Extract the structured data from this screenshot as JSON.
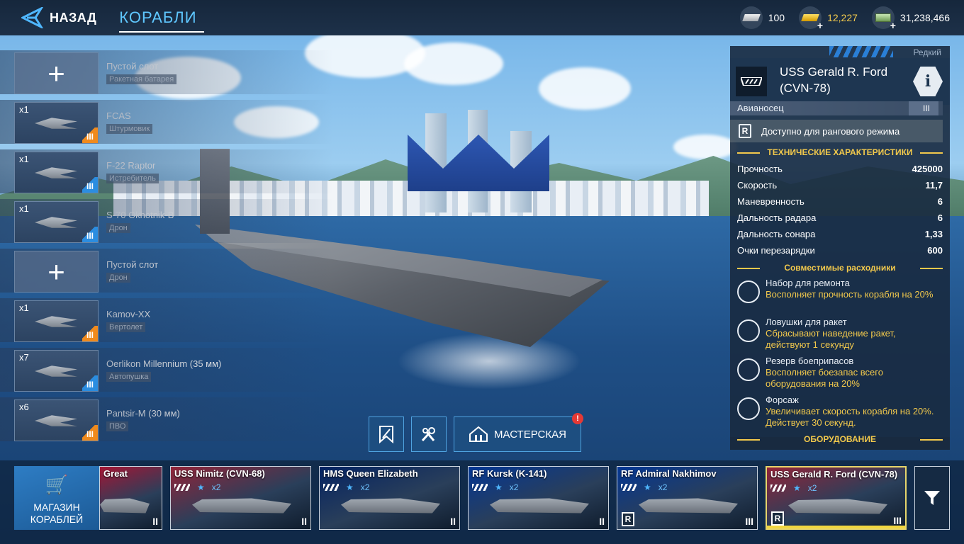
{
  "header": {
    "back_label": "НАЗАД",
    "title": "КОРАБЛИ",
    "currencies": [
      {
        "icon": "silver-bar-icon",
        "value": "100"
      },
      {
        "icon": "gold-bar-icon",
        "value": "12,227"
      },
      {
        "icon": "cash-icon",
        "value": "31,238,466"
      }
    ]
  },
  "slots": [
    {
      "qty": "",
      "name": "Пустой слот",
      "type": "Ракетная батарея",
      "empty": true
    },
    {
      "qty": "x1",
      "name": "FCAS",
      "type": "Штурмовик",
      "rank": "III",
      "color": "#f08a1c"
    },
    {
      "qty": "x1",
      "name": "F-22 Raptor",
      "type": "Истребитель",
      "rank": "III",
      "color": "#2b8de0"
    },
    {
      "qty": "x1",
      "name": "S-70 Okhotnik-B",
      "type": "Дрон",
      "rank": "III",
      "color": "#2b8de0"
    },
    {
      "qty": "",
      "name": "Пустой слот",
      "type": "Дрон",
      "empty": true
    },
    {
      "qty": "x1",
      "name": "Kamov-XX",
      "type": "Вертолет",
      "rank": "III",
      "color": "#f08a1c"
    },
    {
      "qty": "x7",
      "name": "Oerlikon Millennium (35 мм)",
      "type": "Автопушка",
      "rank": "III",
      "color": "#2b8de0"
    },
    {
      "qty": "x6",
      "name": "Pantsir-M (30 мм)",
      "type": "ПВО",
      "rank": "III",
      "color": "#f08a1c"
    }
  ],
  "panel": {
    "rarity": "Редкий",
    "ship_name": "USS Gerald R. Ford (CVN-78)",
    "ship_class": "Авианосец",
    "tier": "III",
    "ranked_text": "Доступно для рангового режима",
    "specs_title": "ТЕХНИЧЕСКИЕ ХАРАКТЕРИСТИКИ",
    "stats": [
      {
        "label": "Прочность",
        "value": "425000"
      },
      {
        "label": "Скорость",
        "value": "11,7"
      },
      {
        "label": "Маневренность",
        "value": "6"
      },
      {
        "label": "Дальность радара",
        "value": "6"
      },
      {
        "label": "Дальность сонара",
        "value": "1,33"
      },
      {
        "label": "Очки перезарядки",
        "value": "600"
      }
    ],
    "consumables_title": "Совместимые расходники",
    "consumables": [
      {
        "name": "Набор для ремонта",
        "desc": "Восполняет прочность корабля на 20%",
        "icon": "repair-kit-icon"
      },
      {
        "name": "Ловушки для ракет",
        "desc": "Сбрасывают наведение ракет, действуют 1 секунду",
        "icon": "flares-icon"
      },
      {
        "name": "Резерв боеприпасов",
        "desc": "Восполняет боезапас всего оборудования на 20%",
        "icon": "ammo-reserve-icon"
      },
      {
        "name": "Форсаж",
        "desc": "Увеличивает скорость корабля на 20%. Действует 30 секунд.",
        "icon": "afterburner-icon"
      }
    ],
    "equipment_title": "ОБОРУДОВАНИЕ"
  },
  "actions": {
    "workshop_label": "МАСТЕРСКАЯ",
    "workshop_badge": "!"
  },
  "carousel": {
    "shop_label": "МАГАЗИН КОРАБЛЕЙ",
    "ships": [
      {
        "name": "Great",
        "stars": "",
        "tier": "II",
        "ranked": false,
        "flag": "#c8102e",
        "selected": false
      },
      {
        "name": "USS Nimitz (CVN-68)",
        "stars": "x2",
        "tier": "II",
        "ranked": false,
        "flag": "#b22234",
        "selected": false
      },
      {
        "name": "HMS Queen Elizabeth",
        "stars": "x2",
        "tier": "II",
        "ranked": false,
        "flag": "#012169",
        "selected": false
      },
      {
        "name": "RF Kursk (K-141)",
        "stars": "x2",
        "tier": "II",
        "ranked": false,
        "flag": "#0039a6",
        "selected": false
      },
      {
        "name": "RF Admiral Nakhimov",
        "stars": "x2",
        "tier": "III",
        "ranked": true,
        "flag": "#0039a6",
        "selected": false
      },
      {
        "name": "USS Gerald R. Ford (CVN-78)",
        "stars": "x2",
        "tier": "III",
        "ranked": true,
        "flag": "#b22234",
        "selected": true
      }
    ]
  }
}
